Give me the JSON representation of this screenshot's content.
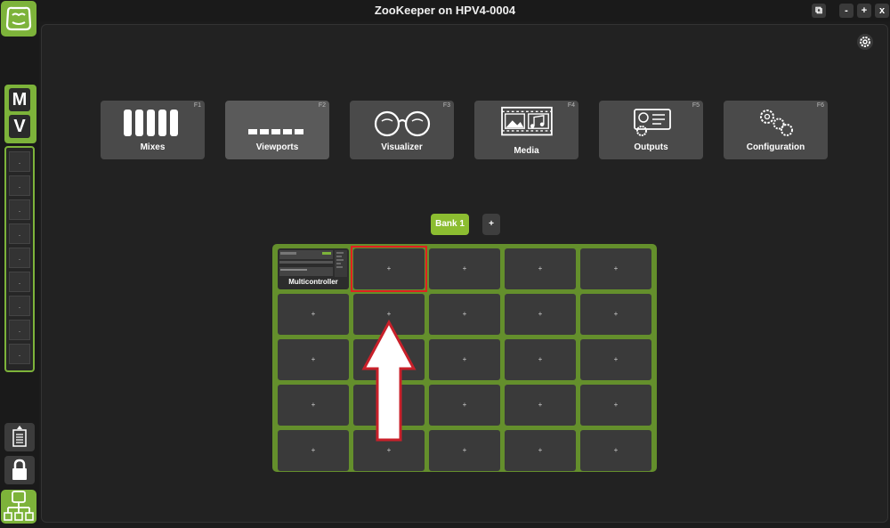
{
  "window": {
    "title": "ZooKeeper on HPV4-0004",
    "btn_pip": "⧉",
    "btn_min": "-",
    "btn_max": "+",
    "btn_close": "x"
  },
  "sidebar": {
    "mv": [
      "M",
      "V"
    ],
    "slots": [
      ".",
      ".",
      ".",
      ".",
      ".",
      ".",
      ".",
      ".",
      "."
    ]
  },
  "modes": [
    {
      "label": "Mixes",
      "key": "F1"
    },
    {
      "label": "Viewports",
      "key": "F2"
    },
    {
      "label": "Visualizer",
      "key": "F3"
    },
    {
      "label": "Media",
      "key": "F4"
    },
    {
      "label": "Outputs",
      "key": "F5"
    },
    {
      "label": "Configuration",
      "key": "F6"
    }
  ],
  "bank": {
    "current": "Bank 1",
    "add_label": "+"
  },
  "grid": {
    "first_cell_label": "Multicontroller",
    "empty_label": "+"
  },
  "colors": {
    "accent": "#7db33a",
    "grid_bg": "#648f2c",
    "highlight": "#e02020"
  }
}
